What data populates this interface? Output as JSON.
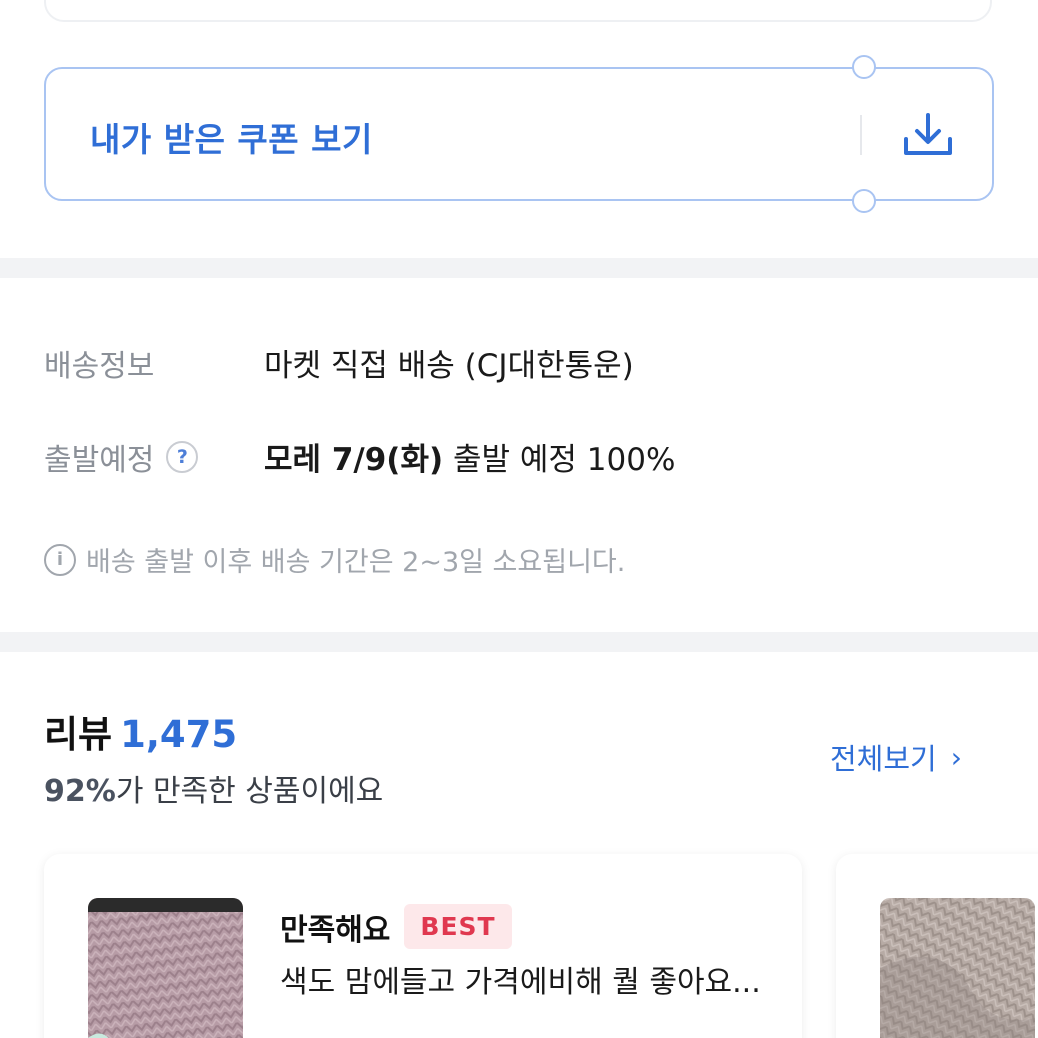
{
  "coupon": {
    "label": "내가 받은 쿠폰 보기",
    "icon": "download-icon",
    "accent": "#2f6ed6"
  },
  "shipping": {
    "info_label": "배송정보",
    "info_value": "마켓 직접 배송 (CJ대한통운)",
    "departure_label": "출발예정",
    "help_icon_text": "?",
    "departure_bold": "모레 7/9(화)",
    "departure_rest": " 출발 예정 100%",
    "notice_icon_text": "i",
    "notice": "배송 출발 이후 배송 기간은 2~3일 소요됩니다."
  },
  "reviews": {
    "title": "리뷰",
    "count": "1,475",
    "satisfaction_pct": "92%",
    "satisfaction_text": "가 만족한 상품이에요",
    "see_all": "전체보기",
    "see_all_chevron": "›",
    "cards": [
      {
        "title": "만족해요",
        "badge": "BEST",
        "body": "색도 맘에들고 가격에비해 퀄 좋아요..."
      }
    ]
  }
}
